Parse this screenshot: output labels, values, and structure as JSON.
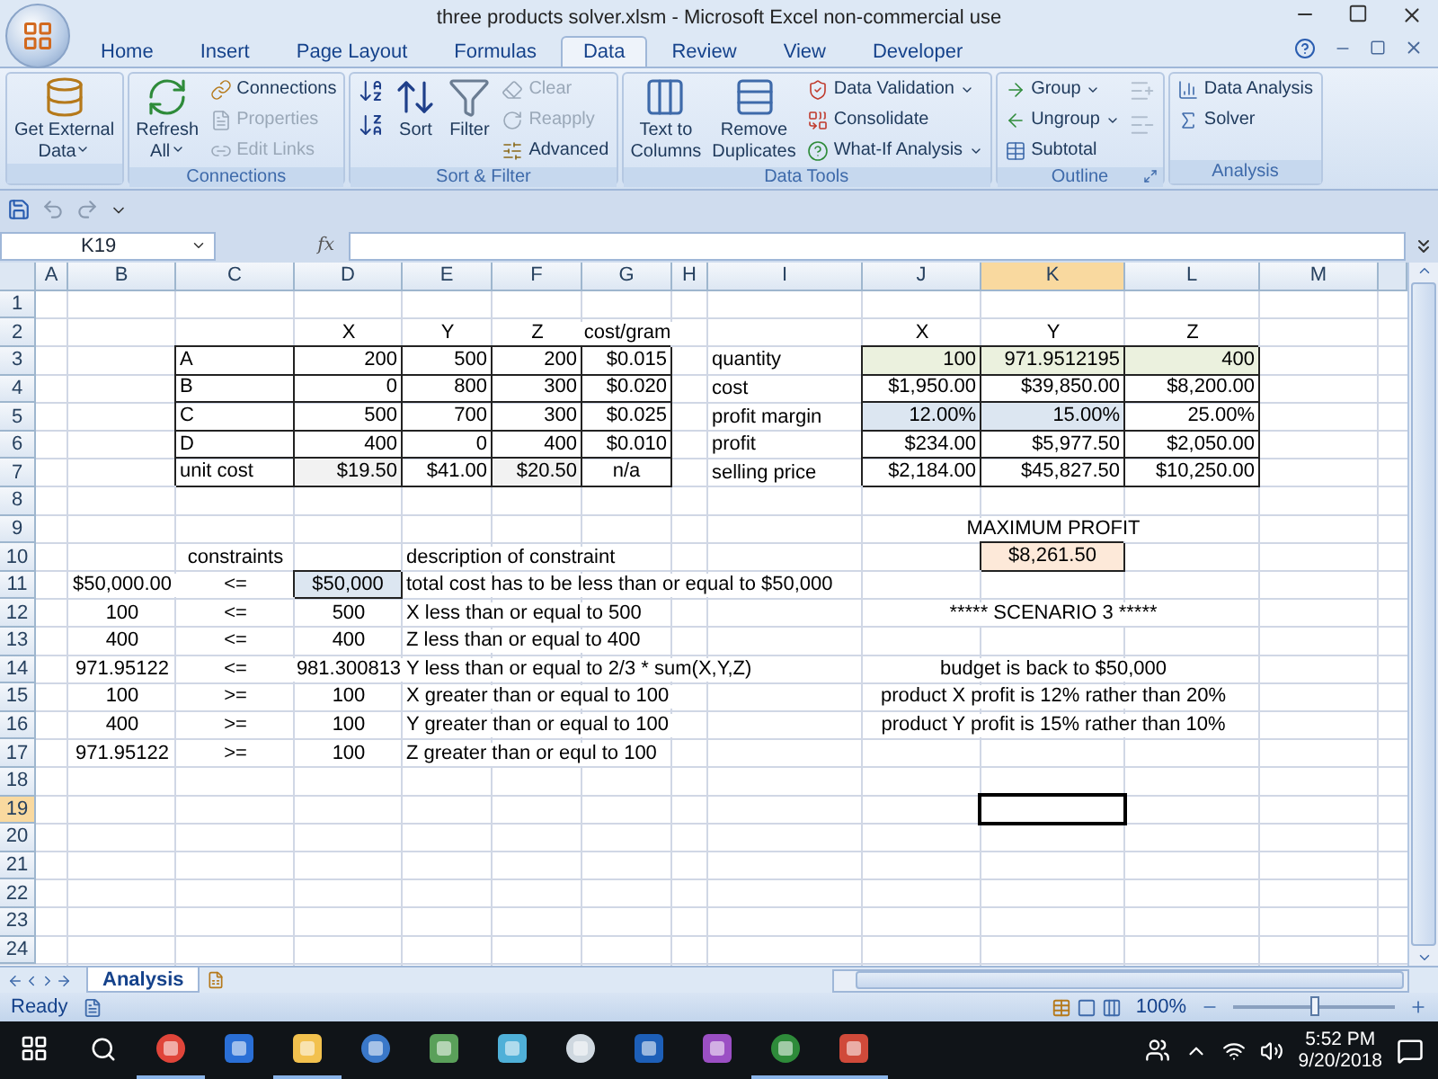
{
  "window": {
    "title": "three products solver.xlsm - Microsoft Excel non-commercial use"
  },
  "tabs": [
    {
      "label": "Home",
      "selected": false
    },
    {
      "label": "Insert",
      "selected": false
    },
    {
      "label": "Page Layout",
      "selected": false
    },
    {
      "label": "Formulas",
      "selected": false
    },
    {
      "label": "Data",
      "selected": true
    },
    {
      "label": "Review",
      "selected": false
    },
    {
      "label": "View",
      "selected": false
    },
    {
      "label": "Developer",
      "selected": false
    }
  ],
  "ribbon_groups": [
    {
      "items": [
        {
          "kind": "large",
          "lines": [
            "Get External",
            "Data"
          ],
          "dropdown": true,
          "disabled": false
        }
      ]
    },
    {
      "label": "Connections",
      "items": [
        {
          "kind": "large",
          "lines": [
            "Refresh",
            "All"
          ],
          "dropdown": true,
          "disabled": false
        },
        {
          "kind": "small",
          "label": "Connections",
          "dropdown": false,
          "disabled": false
        },
        {
          "kind": "small",
          "label": "Properties",
          "dropdown": false,
          "disabled": true
        },
        {
          "kind": "small",
          "label": "Edit Links",
          "dropdown": false,
          "disabled": true
        }
      ]
    },
    {
      "label": "Sort & Filter",
      "items": [
        {
          "kind": "icon",
          "disabled": false
        },
        {
          "kind": "icon",
          "disabled": false
        },
        {
          "kind": "large",
          "lines": [
            "Sort"
          ],
          "dropdown": false,
          "disabled": false
        },
        {
          "kind": "large",
          "lines": [
            "Filter"
          ],
          "dropdown": false,
          "disabled": false
        },
        {
          "kind": "small",
          "label": "Clear",
          "dropdown": false,
          "disabled": true
        },
        {
          "kind": "small",
          "label": "Reapply",
          "dropdown": false,
          "disabled": true
        },
        {
          "kind": "small",
          "label": "Advanced",
          "dropdown": false,
          "disabled": false
        }
      ]
    },
    {
      "label": "Data Tools",
      "items": [
        {
          "kind": "large",
          "lines": [
            "Text to",
            "Columns"
          ],
          "dropdown": false,
          "disabled": false
        },
        {
          "kind": "large",
          "lines": [
            "Remove",
            "Duplicates"
          ],
          "dropdown": false,
          "disabled": false
        },
        {
          "kind": "small",
          "label": "Data Validation",
          "dropdown": true,
          "disabled": false
        },
        {
          "kind": "small",
          "label": "Consolidate",
          "dropdown": false,
          "disabled": false
        },
        {
          "kind": "small",
          "label": "What-If Analysis",
          "dropdown": true,
          "disabled": false
        }
      ]
    },
    {
      "label": "Outline",
      "launcher": true,
      "items": [
        {
          "kind": "small",
          "label": "Group",
          "dropdown": true,
          "disabled": false
        },
        {
          "kind": "small",
          "label": "Ungroup",
          "dropdown": true,
          "disabled": false
        },
        {
          "kind": "small",
          "label": "Subtotal",
          "dropdown": false,
          "disabled": false
        },
        {
          "kind": "icon",
          "disabled": true
        },
        {
          "kind": "icon",
          "disabled": true
        }
      ]
    },
    {
      "label": "Analysis",
      "items": [
        {
          "kind": "small",
          "label": "Data Analysis",
          "dropdown": false,
          "disabled": false
        },
        {
          "kind": "small",
          "label": "Solver",
          "dropdown": false,
          "disabled": false
        }
      ]
    }
  ],
  "formula_bar": {
    "name_box": "K19",
    "function_label": "fx"
  },
  "columns": [
    {
      "label": "A",
      "selected": false
    },
    {
      "label": "B",
      "selected": false
    },
    {
      "label": "C",
      "selected": false
    },
    {
      "label": "D",
      "selected": false
    },
    {
      "label": "E",
      "selected": false
    },
    {
      "label": "F",
      "selected": false
    },
    {
      "label": "G",
      "selected": false
    },
    {
      "label": "H",
      "selected": false
    },
    {
      "label": "I",
      "selected": false
    },
    {
      "label": "J",
      "selected": false
    },
    {
      "label": "K",
      "selected": true
    },
    {
      "label": "L",
      "selected": false
    },
    {
      "label": "M",
      "selected": false
    }
  ],
  "rows": [
    {
      "number": "1",
      "selected": false
    },
    {
      "number": "2",
      "selected": false,
      "cells": [
        {},
        {},
        {},
        {
          "kind": "center",
          "text": "X"
        },
        {
          "kind": "center",
          "text": "Y"
        },
        {
          "kind": "center",
          "text": "Z"
        },
        {
          "kind": "center",
          "text": "cost/gram"
        },
        {},
        {},
        {
          "kind": "center",
          "text": "X"
        },
        {
          "kind": "center",
          "text": "Y"
        },
        {
          "kind": "center",
          "text": "Z"
        }
      ]
    },
    {
      "number": "3",
      "selected": false,
      "cells": [
        {},
        {},
        {
          "kind": "text",
          "text": "A",
          "boxed": true
        },
        {
          "kind": "number",
          "text": "200",
          "boxed": true
        },
        {
          "kind": "number",
          "text": "500",
          "boxed": true
        },
        {
          "kind": "number",
          "text": "200",
          "boxed": true
        },
        {
          "kind": "number",
          "text": "$0.015",
          "boxed": true
        },
        {},
        {
          "kind": "text",
          "text": "quantity"
        },
        {
          "kind": "number",
          "text": "100",
          "boxed": true,
          "color": "#ebf1de"
        },
        {
          "kind": "number",
          "text": "971.9512195",
          "boxed": true,
          "color": "#ebf1de"
        },
        {
          "kind": "number",
          "text": "400",
          "boxed": true,
          "color": "#ebf1de"
        }
      ]
    },
    {
      "number": "4",
      "selected": false,
      "cells": [
        {},
        {},
        {
          "kind": "text",
          "text": "B",
          "boxed": true
        },
        {
          "kind": "number",
          "text": "0",
          "boxed": true
        },
        {
          "kind": "number",
          "text": "800",
          "boxed": true
        },
        {
          "kind": "number",
          "text": "300",
          "boxed": true
        },
        {
          "kind": "number",
          "text": "$0.020",
          "boxed": true
        },
        {},
        {
          "kind": "text",
          "text": "cost"
        },
        {
          "kind": "number",
          "text": "$1,950.00",
          "boxed": true
        },
        {
          "kind": "number",
          "text": "$39,850.00",
          "boxed": true
        },
        {
          "kind": "number",
          "text": "$8,200.00",
          "boxed": true
        }
      ]
    },
    {
      "number": "5",
      "selected": false,
      "cells": [
        {},
        {},
        {
          "kind": "text",
          "text": "C",
          "boxed": true
        },
        {
          "kind": "number",
          "text": "500",
          "boxed": true
        },
        {
          "kind": "number",
          "text": "700",
          "boxed": true
        },
        {
          "kind": "number",
          "text": "300",
          "boxed": true
        },
        {
          "kind": "number",
          "text": "$0.025",
          "boxed": true
        },
        {},
        {
          "kind": "text",
          "text": "profit margin"
        },
        {
          "kind": "number",
          "text": "12.00%",
          "boxed": true,
          "color": "#dce6f1"
        },
        {
          "kind": "number",
          "text": "15.00%",
          "boxed": true,
          "color": "#dce6f1"
        },
        {
          "kind": "number",
          "text": "25.00%",
          "boxed": true
        }
      ]
    },
    {
      "number": "6",
      "selected": false,
      "cells": [
        {},
        {},
        {
          "kind": "text",
          "text": "D",
          "boxed": true
        },
        {
          "kind": "number",
          "text": "400",
          "boxed": true
        },
        {
          "kind": "number",
          "text": "0",
          "boxed": true
        },
        {
          "kind": "number",
          "text": "400",
          "boxed": true
        },
        {
          "kind": "number",
          "text": "$0.010",
          "boxed": true
        },
        {},
        {
          "kind": "text",
          "text": "profit"
        },
        {
          "kind": "number",
          "text": "$234.00",
          "boxed": true
        },
        {
          "kind": "number",
          "text": "$5,977.50",
          "boxed": true
        },
        {
          "kind": "number",
          "text": "$2,050.00",
          "boxed": true
        }
      ]
    },
    {
      "number": "7",
      "selected": false,
      "cells": [
        {},
        {},
        {
          "kind": "text",
          "text": "unit cost",
          "boxed": true
        },
        {
          "kind": "number",
          "text": "$19.50",
          "boxed": true,
          "color": "#f2f2f2"
        },
        {
          "kind": "number",
          "text": "$41.00",
          "boxed": true
        },
        {
          "kind": "number",
          "text": "$20.50",
          "boxed": true,
          "color": "#f2f2f2"
        },
        {
          "kind": "center",
          "text": "n/a",
          "boxed": true
        },
        {},
        {
          "kind": "text",
          "text": "selling price"
        },
        {
          "kind": "number",
          "text": "$2,184.00",
          "boxed": true
        },
        {
          "kind": "number",
          "text": "$45,827.50",
          "boxed": true
        },
        {
          "kind": "number",
          "text": "$10,250.00",
          "boxed": true
        }
      ]
    },
    {
      "number": "8",
      "selected": false
    },
    {
      "number": "9",
      "selected": false,
      "cells": [
        {},
        {},
        {},
        {},
        {},
        {},
        {},
        {},
        {},
        {},
        {
          "kind": "center",
          "text": "MAXIMUM PROFIT"
        }
      ]
    },
    {
      "number": "10",
      "selected": false,
      "cells": [
        {},
        {},
        {
          "kind": "center",
          "text": "constraints"
        },
        {},
        {
          "kind": "text",
          "text": "description of constraint"
        },
        {},
        {},
        {},
        {},
        {},
        {
          "kind": "center",
          "text": "$8,261.50",
          "boxed": true,
          "color": "#fde9d9"
        }
      ]
    },
    {
      "number": "11",
      "selected": false,
      "cells": [
        {},
        {
          "kind": "center",
          "text": "$50,000.00"
        },
        {
          "kind": "center",
          "text": "<="
        },
        {
          "kind": "center",
          "text": "$50,000",
          "boxed": true,
          "color": "#dce6f1"
        },
        {
          "kind": "text",
          "text": "total cost has to be less than or equal to $50,000"
        }
      ]
    },
    {
      "number": "12",
      "selected": false,
      "cells": [
        {},
        {
          "kind": "center",
          "text": "100"
        },
        {
          "kind": "center",
          "text": "<="
        },
        {
          "kind": "center",
          "text": "500"
        },
        {
          "kind": "text",
          "text": "X less than or equal to 500"
        },
        {},
        {},
        {},
        {},
        {},
        {
          "kind": "center",
          "text": "***** SCENARIO 3 *****"
        }
      ]
    },
    {
      "number": "13",
      "selected": false,
      "cells": [
        {},
        {
          "kind": "center",
          "text": "400"
        },
        {
          "kind": "center",
          "text": "<="
        },
        {
          "kind": "center",
          "text": "400"
        },
        {
          "kind": "text",
          "text": "Z less than or equal to 400"
        }
      ]
    },
    {
      "number": "14",
      "selected": false,
      "cells": [
        {},
        {
          "kind": "center",
          "text": "971.95122"
        },
        {
          "kind": "center",
          "text": "<="
        },
        {
          "kind": "center",
          "text": "981.300813"
        },
        {
          "kind": "text",
          "text": "Y less than or equal to 2/3 * sum(X,Y,Z)"
        },
        {},
        {},
        {},
        {},
        {},
        {
          "kind": "center",
          "text": "budget is back to $50,000"
        }
      ]
    },
    {
      "number": "15",
      "selected": false,
      "cells": [
        {},
        {
          "kind": "center",
          "text": "100"
        },
        {
          "kind": "center",
          "text": ">="
        },
        {
          "kind": "center",
          "text": "100"
        },
        {
          "kind": "text",
          "text": "X greater than or equal to 100"
        },
        {},
        {},
        {},
        {},
        {},
        {
          "kind": "center",
          "text": "product X profit is 12% rather than 20%"
        }
      ]
    },
    {
      "number": "16",
      "selected": false,
      "cells": [
        {},
        {
          "kind": "center",
          "text": "400"
        },
        {
          "kind": "center",
          "text": ">="
        },
        {
          "kind": "center",
          "text": "100"
        },
        {
          "kind": "text",
          "text": "Y greater than or equal to 100"
        },
        {},
        {},
        {},
        {},
        {},
        {
          "kind": "center",
          "text": "product Y profit is 15% rather than 10%"
        }
      ]
    },
    {
      "number": "17",
      "selected": false,
      "cells": [
        {},
        {
          "kind": "center",
          "text": "971.95122"
        },
        {
          "kind": "center",
          "text": ">="
        },
        {
          "kind": "center",
          "text": "100"
        },
        {
          "kind": "text",
          "text": "Z greater than or equl to 100"
        }
      ]
    },
    {
      "number": "18",
      "selected": false
    },
    {
      "number": "19",
      "selected": true
    },
    {
      "number": "20",
      "selected": false
    },
    {
      "number": "21",
      "selected": false
    },
    {
      "number": "22",
      "selected": false
    },
    {
      "number": "23",
      "selected": false
    },
    {
      "number": "24",
      "selected": false
    }
  ],
  "sheet_tabs": [
    {
      "label": "Analysis",
      "selected": true
    }
  ],
  "status_bar": {
    "text": "Ready",
    "zoom": "100%",
    "zoom_level": {
      "level": 0.5
    }
  },
  "taskbar": {
    "apps": [
      {
        "open": true
      },
      {
        "open": false
      },
      {
        "open": true
      },
      {
        "open": false
      },
      {
        "open": false
      },
      {
        "open": false
      },
      {
        "open": false
      },
      {
        "open": false
      },
      {
        "open": false
      },
      {
        "open": true
      },
      {
        "open": true
      }
    ],
    "time": "5:52 PM",
    "date": "9/20/2018"
  }
}
